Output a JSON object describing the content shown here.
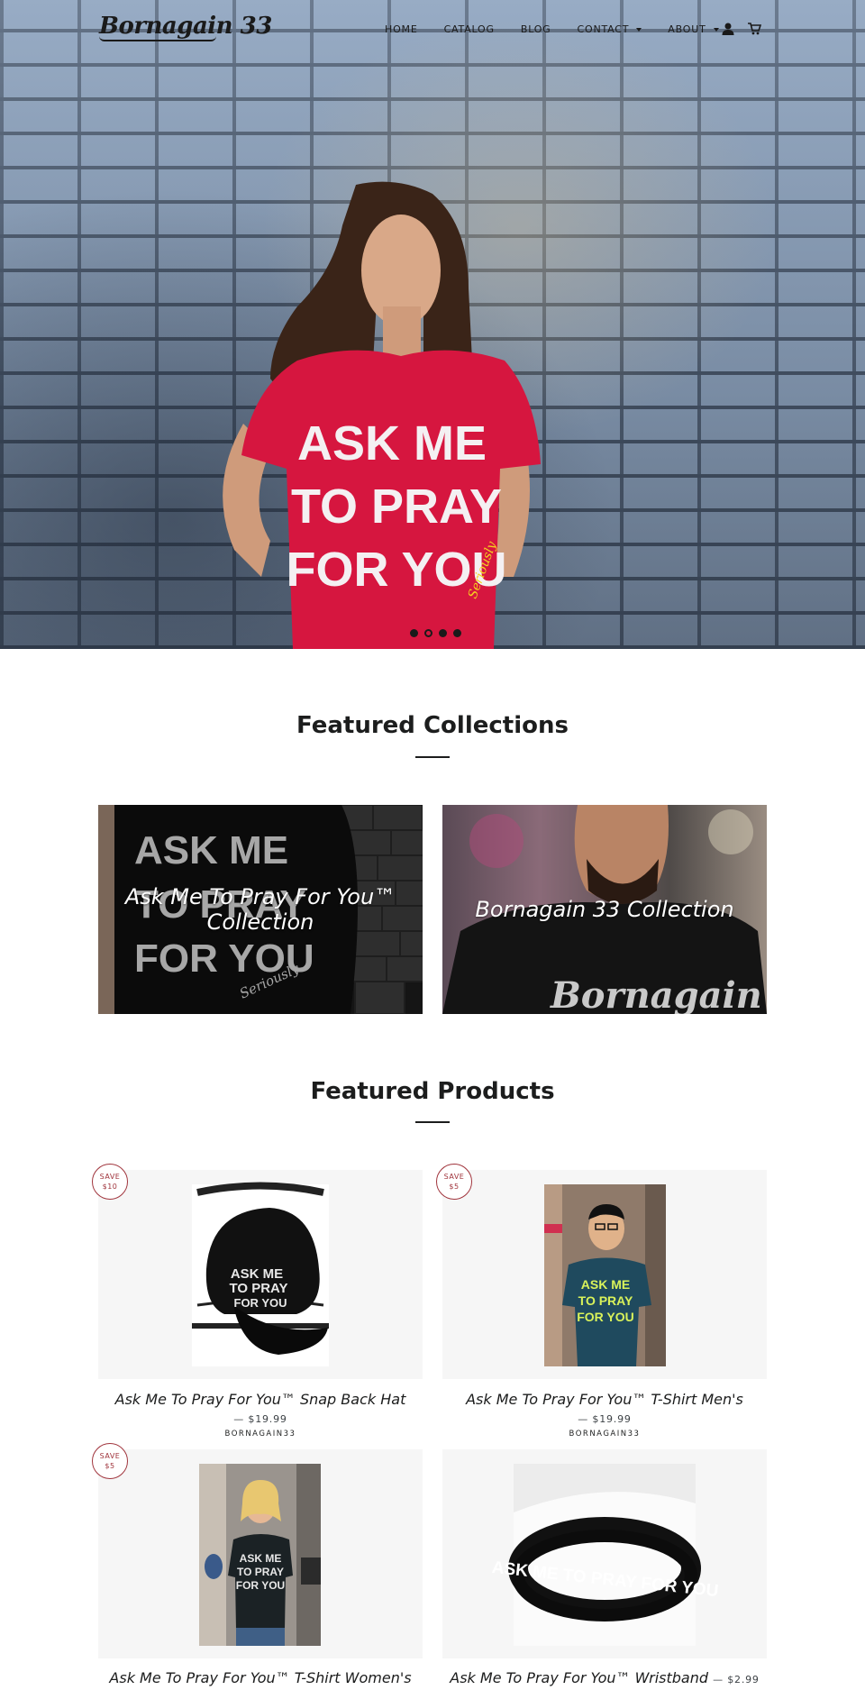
{
  "header": {
    "logo_text": "Bornagain 33",
    "nav": [
      {
        "label": "HOME",
        "has_dropdown": false
      },
      {
        "label": "CATALOG",
        "has_dropdown": false
      },
      {
        "label": "BLOG",
        "has_dropdown": false
      },
      {
        "label": "CONTACT",
        "has_dropdown": true
      },
      {
        "label": "ABOUT",
        "has_dropdown": true
      }
    ],
    "icons": [
      "account-icon",
      "cart-icon"
    ]
  },
  "hero": {
    "shirt_text_line1": "ASK ME",
    "shirt_text_line2": "TO PRAY",
    "shirt_text_line3": "FOR YOU",
    "shirt_signature": "Seriously",
    "slide_count": 4,
    "active_slide": 2
  },
  "featured_collections": {
    "title": "Featured Collections",
    "items": [
      {
        "label": "Ask Me To Pray For You™ Collection",
        "shirt_text_line1": "ASK ME",
        "shirt_text_line2": "TO PRAY",
        "shirt_text_line3": "FOR YOU",
        "shirt_signature": "Seriously"
      },
      {
        "label": "Bornagain 33 Collection",
        "shirt_text": "Bornagain"
      }
    ]
  },
  "featured_products": {
    "title": "Featured Products",
    "items": [
      {
        "title": "Ask Me To Pray For You™ Snap Back Hat",
        "price": "$19.99",
        "vendor": "BORNAGAIN33",
        "badge_line1": "SAVE",
        "badge_line2": "$10",
        "image_text_line1": "ASK ME",
        "image_text_line2": "TO PRAY",
        "image_text_line3": "FOR YOU"
      },
      {
        "title": "Ask Me To Pray For You™ T-Shirt Men's",
        "price": "$19.99",
        "vendor": "BORNAGAIN33",
        "badge_line1": "SAVE",
        "badge_line2": "$5",
        "image_text_line1": "ASK ME",
        "image_text_line2": "TO PRAY",
        "image_text_line3": "FOR YOU"
      },
      {
        "title": "Ask Me To Pray For You™ T-Shirt Women's",
        "price": "",
        "vendor": "",
        "badge_line1": "SAVE",
        "badge_line2": "$5",
        "image_text_line1": "ASK ME",
        "image_text_line2": "TO PRAY",
        "image_text_line3": "FOR YOU"
      },
      {
        "title": "Ask Me To Pray For You™ Wristband",
        "price": "$2.99",
        "vendor": "",
        "image_text": "ASK ME TO PRAY FOR YOU"
      }
    ]
  },
  "colors": {
    "text": "#1c1d1d",
    "badge": "#a0343c",
    "hero_shirt": "#d6163f",
    "product_bg": "#f6f6f6"
  }
}
